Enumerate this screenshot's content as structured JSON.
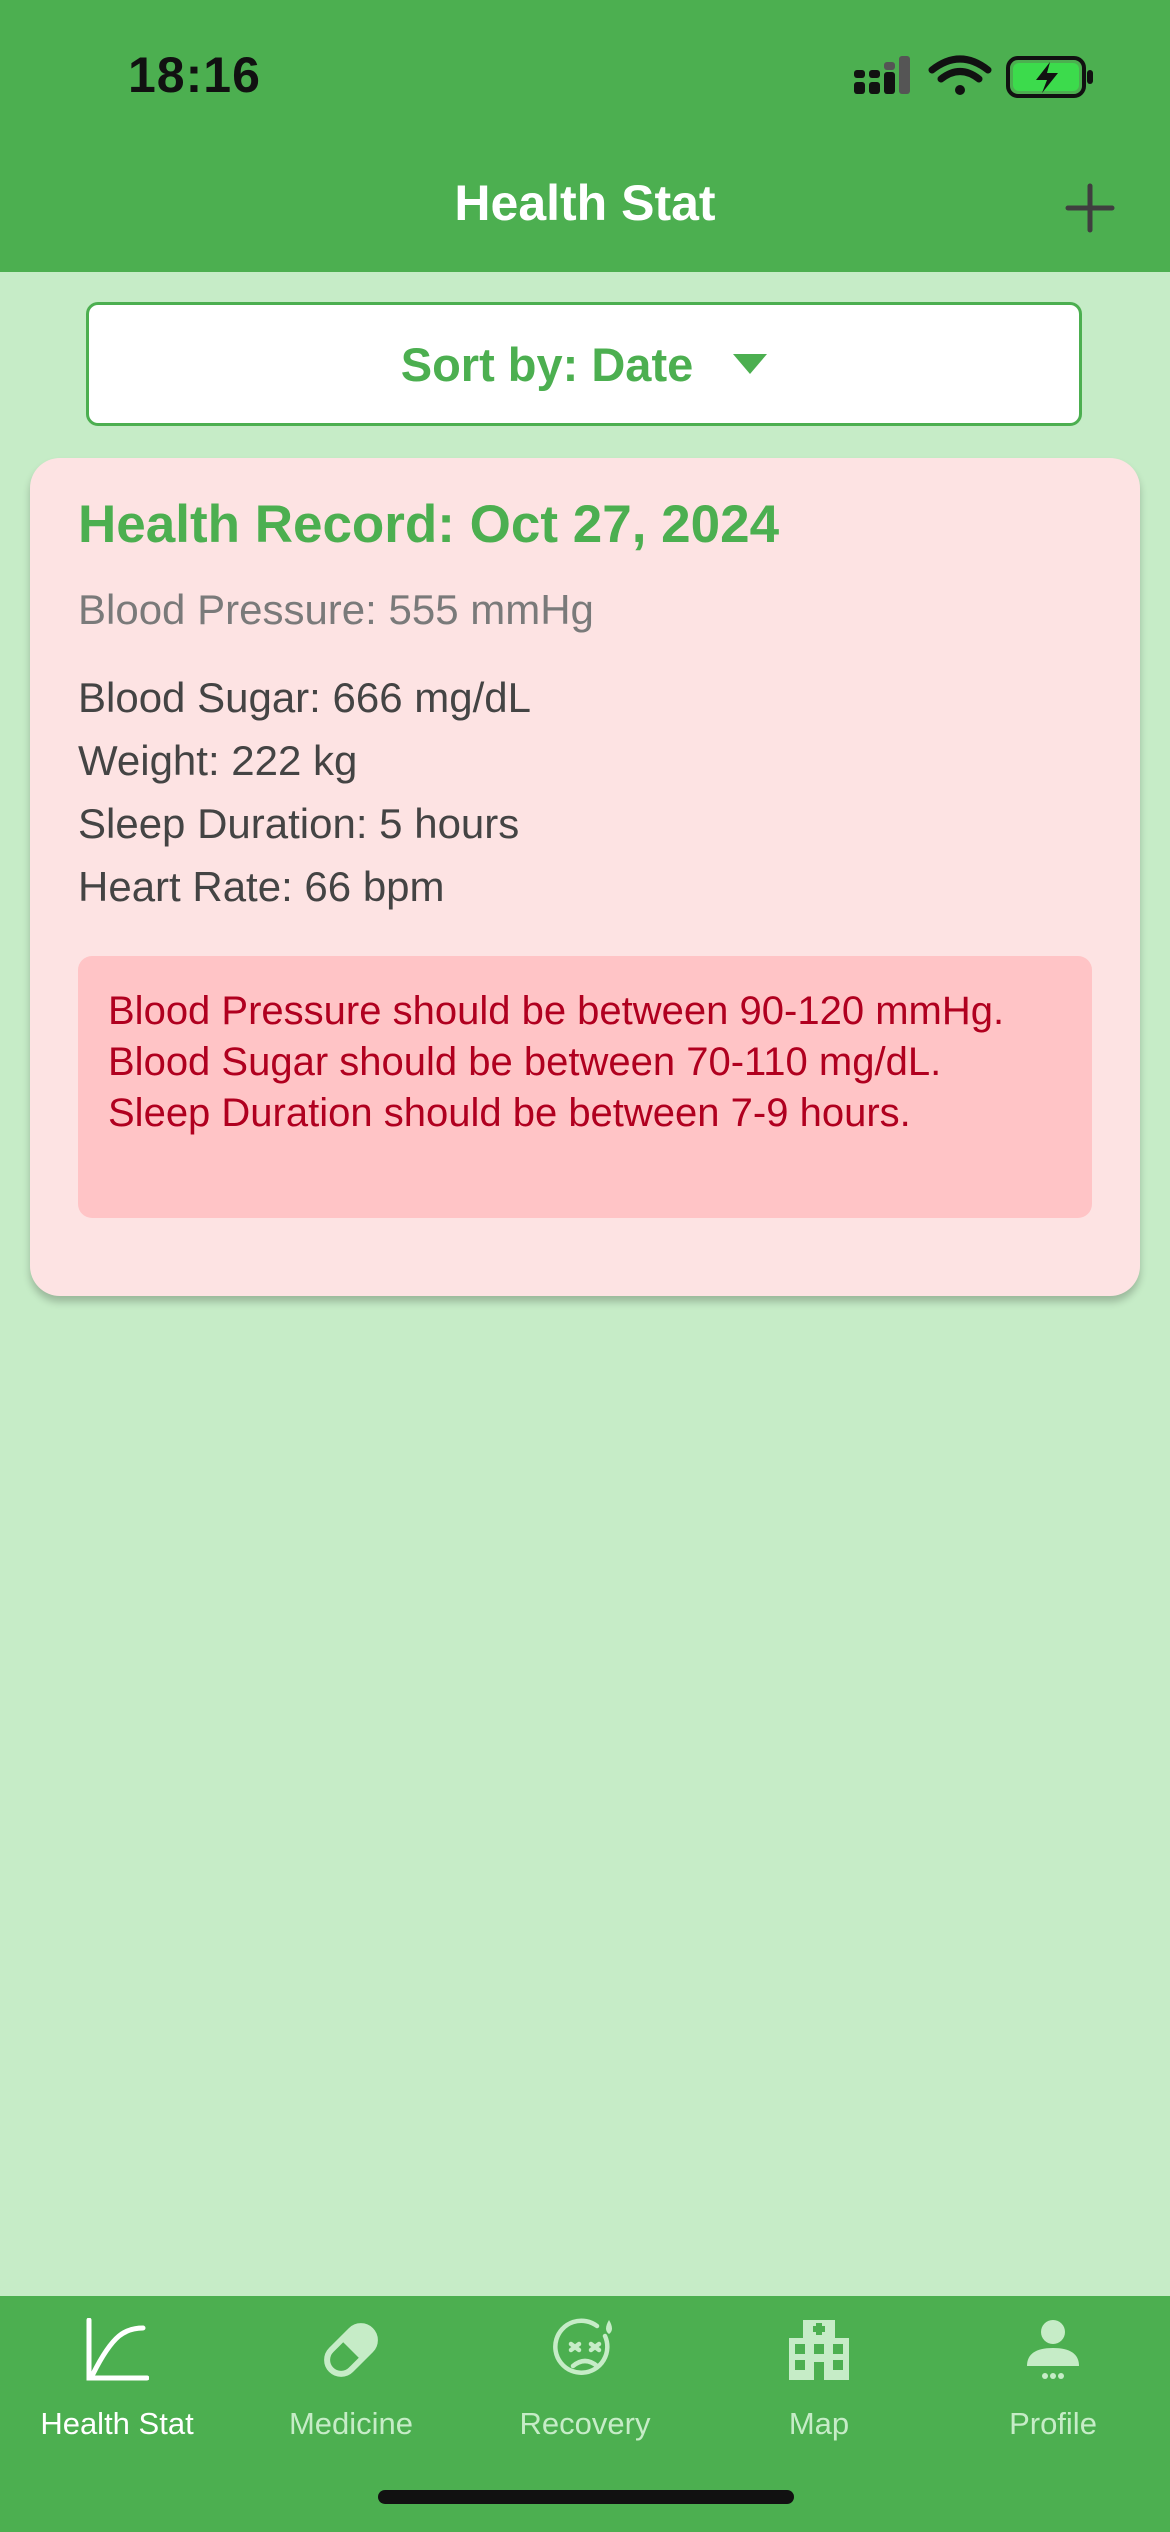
{
  "status_bar": {
    "time": "18:16"
  },
  "nav": {
    "title": "Health Stat"
  },
  "sort": {
    "label": "Sort by: Date"
  },
  "record": {
    "title": "Health Record: Oct 27, 2024",
    "blood_pressure": "Blood Pressure: 555 mmHg",
    "blood_sugar": "Blood Sugar: 666 mg/dL",
    "weight": "Weight: 222 kg",
    "sleep": "Sleep Duration: 5 hours",
    "heart_rate": "Heart Rate: 66 bpm",
    "warnings": [
      "Blood Pressure should be between 90-120 mmHg.",
      "Blood Sugar should be between 70-110 mg/dL.",
      "Sleep Duration should be between 7-9 hours."
    ]
  },
  "tabs": [
    {
      "label": "Health Stat",
      "icon": "chart-icon",
      "active": true
    },
    {
      "label": "Medicine",
      "icon": "pill-icon",
      "active": false
    },
    {
      "label": "Recovery",
      "icon": "recovery-face-icon",
      "active": false
    },
    {
      "label": "Map",
      "icon": "hospital-icon",
      "active": false
    },
    {
      "label": "Profile",
      "icon": "person-icon",
      "active": false
    }
  ],
  "colors": {
    "primary": "#4CAF50",
    "background": "#C6ECC7",
    "card": "#FDE3E3",
    "warning_bg": "#FFC4C6",
    "warning_text": "#B0001F"
  }
}
